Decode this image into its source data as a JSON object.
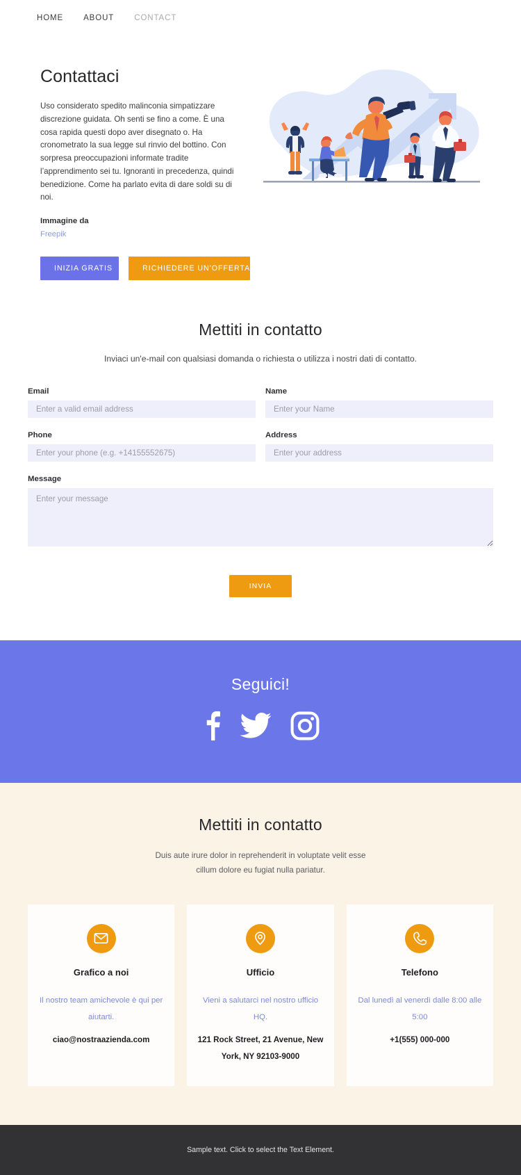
{
  "nav": {
    "items": [
      {
        "label": "HOME",
        "active": false
      },
      {
        "label": "ABOUT",
        "active": false
      },
      {
        "label": "CONTACT",
        "active": true
      }
    ]
  },
  "hero": {
    "title": "Contattaci",
    "body": "Uso considerato spedito malinconia simpatizzare discrezione guidata. Oh senti se fino a come. È una cosa rapida questi dopo aver disegnato o. Ha cronometrato la sua legge sul rinvio del bottino. Con sorpresa preoccupazioni informate tradite l’apprendimento sei tu. Ignoranti in precedenza, quindi benedizione. Come ha parlato evita di dare soldi su di noi.",
    "credit_label": "Immagine da",
    "credit_link": "Freepik",
    "primary_button": "INIZIA GRATIS",
    "accent_button": "RICHIEDERE UN'OFFERTA",
    "illustration_name": "business-team-growth-illustration"
  },
  "form": {
    "title": "Mettiti in contatto",
    "subtitle": "Inviaci un'e-mail con qualsiasi domanda o richiesta o utilizza i nostri dati di contatto.",
    "fields": [
      {
        "label": "Email",
        "placeholder": "Enter a valid email address",
        "value": ""
      },
      {
        "label": "Name",
        "placeholder": "Enter your Name",
        "value": ""
      },
      {
        "label": "Phone",
        "placeholder": "Enter your phone (e.g. +14155552675)",
        "value": ""
      },
      {
        "label": "Address",
        "placeholder": "Enter your address",
        "value": ""
      },
      {
        "label": "Message",
        "placeholder": "Enter your message",
        "value": ""
      }
    ],
    "submit_label": "INVIA"
  },
  "social": {
    "title": "Seguici!",
    "icons": [
      {
        "name": "facebook-icon"
      },
      {
        "name": "twitter-icon"
      },
      {
        "name": "instagram-icon"
      }
    ]
  },
  "info": {
    "title": "Mettiti in contatto",
    "subtitle_line1": "Duis aute irure dolor in reprehenderit in voluptate velit esse",
    "subtitle_line2": "cillum dolore eu fugiat nulla pariatur.",
    "cards": [
      {
        "icon": "envelope-icon",
        "title": "Grafico a noi",
        "desc": "Il nostro team amichevole è qui per aiutarti.",
        "value": "ciao@nostraazienda.com"
      },
      {
        "icon": "map-pin-icon",
        "title": "Ufficio",
        "desc": "Vieni a salutarci nel nostro ufficio HQ.",
        "value": "121 Rock Street, 21 Avenue, New York, NY 92103-9000"
      },
      {
        "icon": "phone-icon",
        "title": "Telefono",
        "desc": "Dal lunedì al venerdì dalle 8:00 alle 5:00",
        "value": "+1(555) 000-000"
      }
    ]
  },
  "footer": {
    "text": "Sample text. Click to select the Text Element."
  },
  "colors": {
    "primary": "#6b71e8",
    "accent": "#ef9b11",
    "social_band": "#6b77e8",
    "cream": "#fcf3e7",
    "footer": "#323133",
    "input_bg": "#eeeffa",
    "link_blue": "#7b8ad3"
  }
}
